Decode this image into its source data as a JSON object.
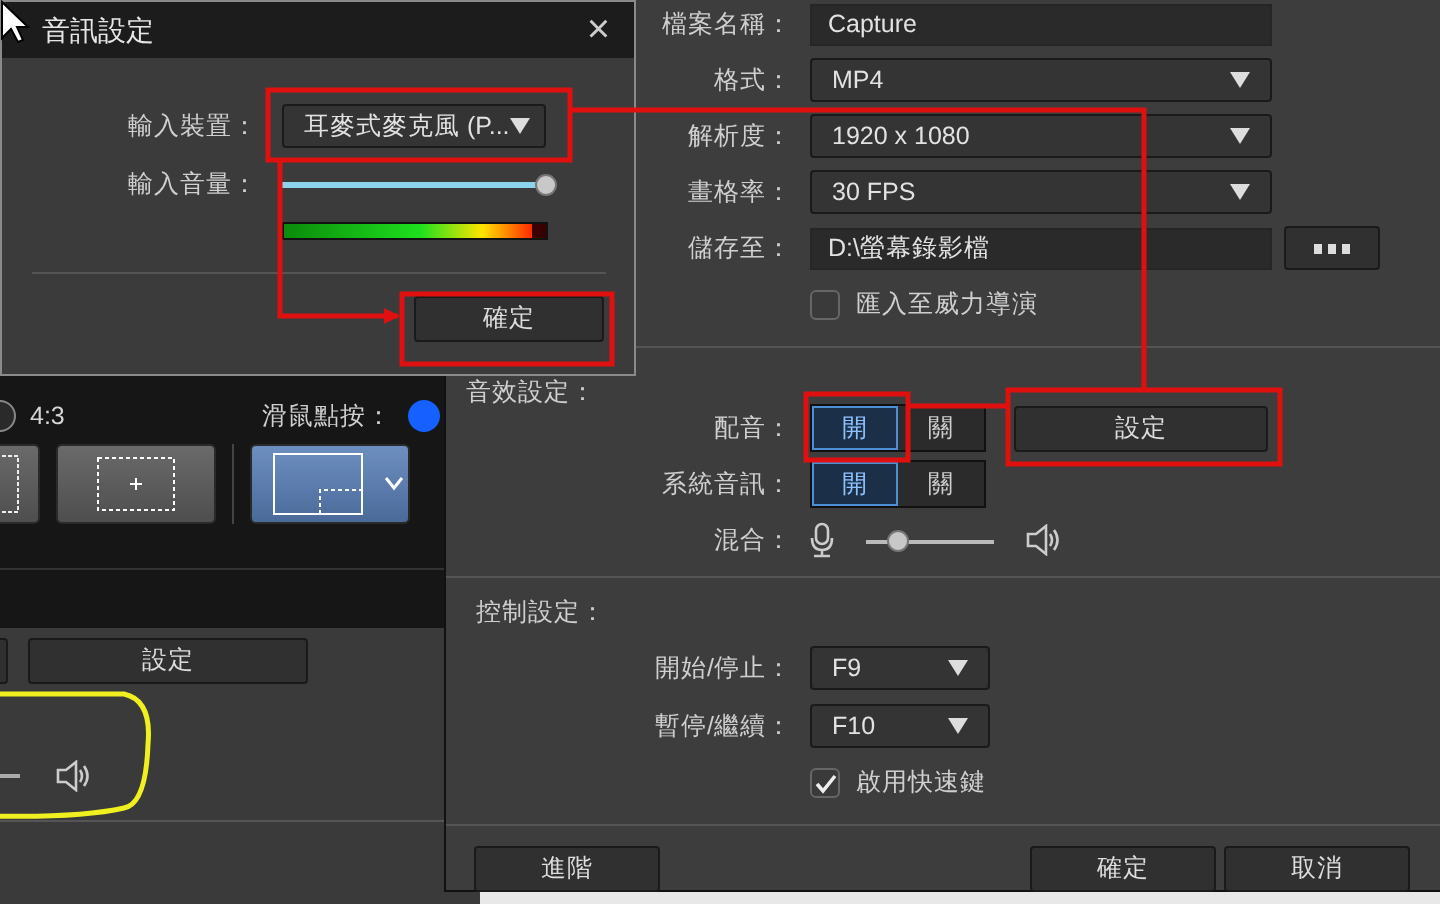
{
  "audio_dialog": {
    "title": "音訊設定",
    "close": "×",
    "input_device": {
      "label": "輸入裝置：",
      "value": "耳麥式麥克風 (P..."
    },
    "input_volume": {
      "label": "輸入音量：",
      "level": 1.0
    },
    "meter": {
      "level": 0.95
    },
    "ok_button": "確定"
  },
  "background_app": {
    "aspect_option": {
      "label": "4:3",
      "selected": false
    },
    "mouse_click": {
      "label": "滑鼠點按：",
      "on": true
    },
    "settings_button": "設定"
  },
  "settings": {
    "fields": [
      {
        "label": "檔案名稱：",
        "value": "Capture",
        "kind": "text"
      },
      {
        "label": "格式：",
        "value": "MP4",
        "kind": "dropdown"
      },
      {
        "label": "解析度：",
        "value": "1920 x 1080",
        "kind": "dropdown"
      },
      {
        "label": "畫格率：",
        "value": "30 FPS",
        "kind": "dropdown"
      },
      {
        "label": "儲存至：",
        "value": "D:\\螢幕錄影檔",
        "kind": "path"
      }
    ],
    "import_option": {
      "label": "匯入至威力導演",
      "checked": false
    },
    "audio_section": "音效設定：",
    "audio_rows": [
      {
        "label": "配音：",
        "kind": "toggle",
        "options": [
          {
            "label": "開",
            "selected": true
          },
          {
            "label": "關",
            "selected": false
          }
        ],
        "button": "設定"
      },
      {
        "label": "系統音訊：",
        "kind": "toggle",
        "options": [
          {
            "label": "開",
            "selected": true
          },
          {
            "label": "關",
            "selected": false
          }
        ]
      },
      {
        "label": "混合：",
        "kind": "slider",
        "level": 0.25
      }
    ],
    "control_section": "控制設定：",
    "hotkeys": [
      {
        "label": "開始/停止：",
        "value": "F9"
      },
      {
        "label": "暫停/繼續：",
        "value": "F10"
      }
    ],
    "hotkey_option": {
      "label": "啟用快速鍵",
      "checked": true
    },
    "buttons": {
      "advanced": "進階",
      "ok": "確定",
      "cancel": "取消"
    }
  }
}
